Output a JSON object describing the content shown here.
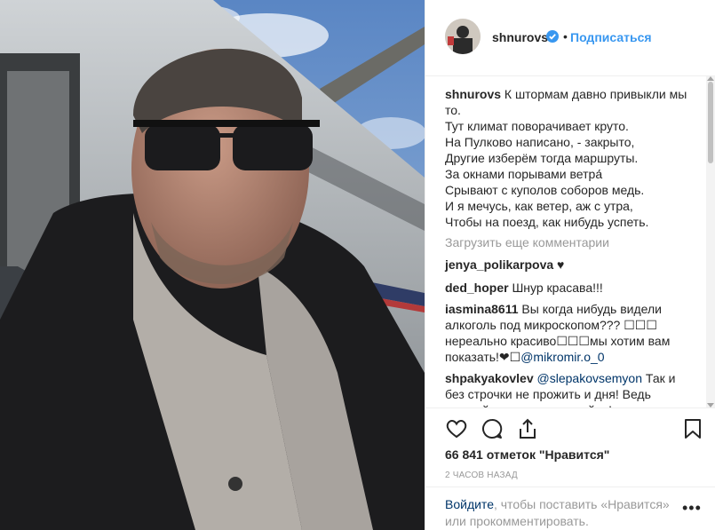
{
  "post": {
    "username": "shnurovs",
    "follow_label": "Подписаться",
    "separator": "•",
    "caption_user": "shnurovs",
    "caption_text": " К штормам давно привыкли мы то.\nТут климат поворачивает круто.\nНа Пулково написано, - закрыто,\nДругие изберём тогда маршруты.\nЗа окнами порывами ветра́\nСрывают с куполов соборов медь.\nИ я мечусь, как ветер, аж с утра,\nЧтобы на поезд, как нибудь успеть.",
    "load_more": "Загрузить еще комментарии",
    "comments": [
      {
        "user": "jenya_polikarpova",
        "text": " ♥"
      },
      {
        "user": "ded_hoper",
        "text": " Шнур красава!!!"
      },
      {
        "user": "iasmina8611",
        "text": " Вы когда нибудь видели алкоголь под микроскопом??? ☐☐☐ нереально красиво☐☐☐мы хотим вам показать!❤☐",
        "mention": "@mikromir.o_0"
      },
      {
        "user": "shpakyakovlev",
        "mention": "@slepakovsemyon",
        "text": " Так и без строчки не прожить и дня! Ведь каждый день какая-то хуйня!"
      }
    ],
    "likes": "66 841 отметок \"Нравится\"",
    "time_ago": "2 ЧАСОВ НАЗАД",
    "login_link": "Войдите",
    "login_text": ", чтобы поставить «Нравится» или прокомментировать.",
    "more_icon": "•••"
  },
  "icons": {
    "verified": "verified-badge-icon",
    "like": "heart-icon",
    "comment": "comment-icon",
    "share": "share-icon",
    "save": "bookmark-icon"
  },
  "colors": {
    "accent": "#3897f0",
    "link": "#003569",
    "muted": "#999999",
    "text": "#262626"
  }
}
